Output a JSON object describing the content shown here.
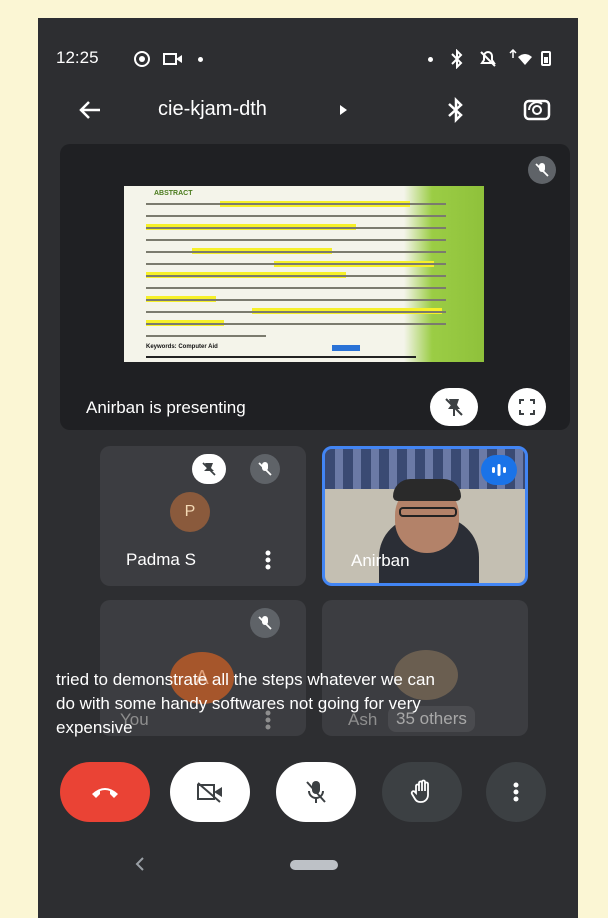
{
  "status_bar": {
    "time": "12:25"
  },
  "header": {
    "meeting_code": "cie-kjam-dth"
  },
  "presentation": {
    "presenter_text": "Anirban is presenting",
    "slide": {
      "heading": "ABSTRACT",
      "keywords": "Keywords: Computer Aid"
    }
  },
  "participants": [
    {
      "name": "Padma S",
      "avatar_initial": "P"
    },
    {
      "name": "Anirban"
    },
    {
      "name": "You",
      "avatar_initial": "A"
    },
    {
      "name": "Ash",
      "others_label": "35 others"
    }
  ],
  "captions": {
    "line1": "tried to demonstrate all the steps whatever we can",
    "line2": "do with some handy softwares not going for very",
    "line3": "expensive"
  },
  "controls": {
    "end_call_color": "#ea4335",
    "button_color": "#3c4043"
  }
}
